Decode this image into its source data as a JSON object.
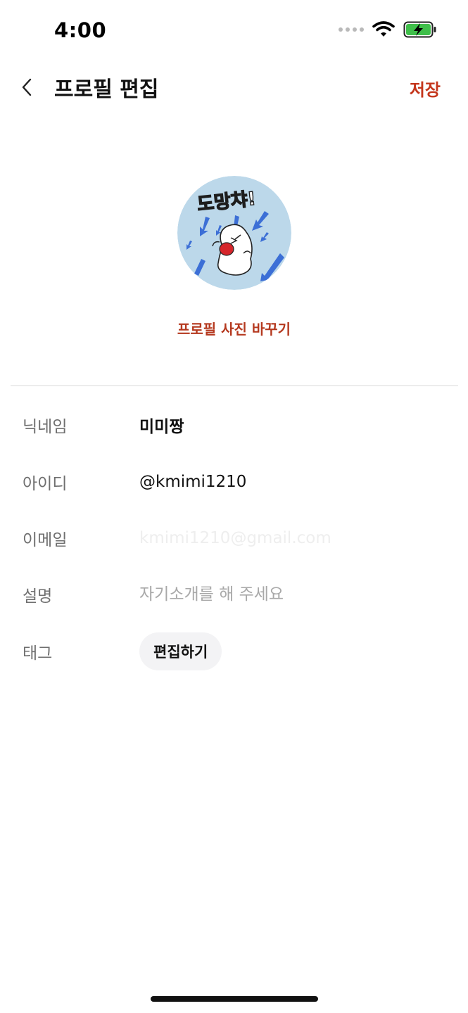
{
  "status_bar": {
    "time": "4:00",
    "battery_color": "#3fbf4a"
  },
  "header": {
    "title": "프로필 편집",
    "save_label": "저장",
    "accent_color": "#c4361c"
  },
  "avatar": {
    "sticker_text": "도망챠!",
    "change_label": "프로필 사진 바꾸기"
  },
  "fields": {
    "nickname": {
      "label": "닉네임",
      "value": "미미짱"
    },
    "user_id": {
      "label": "아이디",
      "value": "@kmimi1210"
    },
    "email": {
      "label": "이메일",
      "value": "kmimi1210@gmail.com"
    },
    "bio": {
      "label": "설명",
      "value": "",
      "placeholder": "자기소개를 해 주세요"
    },
    "tag": {
      "label": "태그",
      "button_label": "편집하기"
    }
  },
  "icons": {
    "back": "chevron-left-icon",
    "signal": "cellular-dots-icon",
    "wifi": "wifi-icon",
    "battery": "battery-charging-icon"
  }
}
